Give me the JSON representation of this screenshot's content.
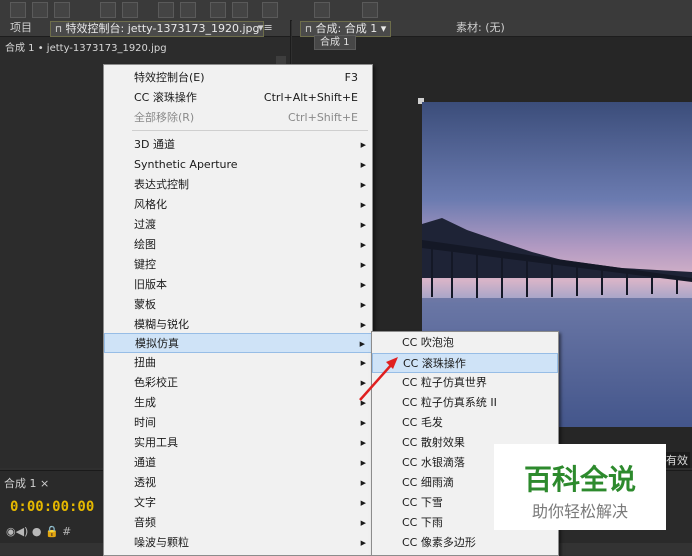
{
  "toolbar": {
    "icons": [
      "selection-tool-icon",
      "hand-tool-icon",
      "zoom-tool-icon",
      "rotate-tool-icon",
      "camera-tool-icon",
      "pan-behind-icon",
      "mask-tool-icon",
      "pen-tool-icon",
      "text-tool-icon",
      "brush-tool-icon",
      "clone-stamp-icon",
      "eraser-tool-icon"
    ]
  },
  "left_panel": {
    "tabs": {
      "project": "项目",
      "effect_controls": "特效控制台: jetty-1373173_1920.jpg",
      "menu_glyph": "▾≡"
    },
    "breadcrumb": "合成 1 • jetty-1373173_1920.jpg"
  },
  "right_panel": {
    "tabs": {
      "composition": "合成: 合成 1",
      "footage": "素材: (无)"
    },
    "comp_button": "合成 1",
    "right_label": "有效"
  },
  "timeline": {
    "tab_label": "合成 1 ×",
    "timecode": "0:00:00:00",
    "controls": "◉◀) ● 🔒   #"
  },
  "context_menu": {
    "items": [
      {
        "label": "特效控制台(E)",
        "shortcut": "F3",
        "submenu": false,
        "disabled": false
      },
      {
        "label": "CC 滚珠操作",
        "shortcut": "Ctrl+Alt+Shift+E",
        "submenu": false,
        "disabled": false
      },
      {
        "label": "全部移除(R)",
        "shortcut": "Ctrl+Shift+E",
        "submenu": false,
        "disabled": true
      },
      {
        "label": "3D 通道",
        "submenu": true
      },
      {
        "label": "Synthetic Aperture",
        "submenu": true
      },
      {
        "label": "表达式控制",
        "submenu": true
      },
      {
        "label": "风格化",
        "submenu": true
      },
      {
        "label": "过渡",
        "submenu": true
      },
      {
        "label": "绘图",
        "submenu": true
      },
      {
        "label": "键控",
        "submenu": true
      },
      {
        "label": "旧版本",
        "submenu": true
      },
      {
        "label": "蒙板",
        "submenu": true
      },
      {
        "label": "模糊与锐化",
        "submenu": true
      },
      {
        "label": "模拟仿真",
        "submenu": true,
        "highlighted": true
      },
      {
        "label": "扭曲",
        "submenu": true
      },
      {
        "label": "色彩校正",
        "submenu": true
      },
      {
        "label": "生成",
        "submenu": true
      },
      {
        "label": "时间",
        "submenu": true
      },
      {
        "label": "实用工具",
        "submenu": true
      },
      {
        "label": "通道",
        "submenu": true
      },
      {
        "label": "透视",
        "submenu": true
      },
      {
        "label": "文字",
        "submenu": true
      },
      {
        "label": "音频",
        "submenu": true
      },
      {
        "label": "噪波与颗粒",
        "submenu": true
      }
    ]
  },
  "submenu": {
    "items": [
      {
        "label": "CC 吹泡泡"
      },
      {
        "label": "CC 滚珠操作",
        "highlighted": true
      },
      {
        "label": "CC 粒子仿真世界"
      },
      {
        "label": "CC 粒子仿真系统 II"
      },
      {
        "label": "CC 毛发"
      },
      {
        "label": "CC 散射效果"
      },
      {
        "label": "CC 水银滴落"
      },
      {
        "label": "CC 细雨滴"
      },
      {
        "label": "CC 下雪"
      },
      {
        "label": "CC 下雨"
      },
      {
        "label": "CC 像素多边形"
      }
    ]
  },
  "watermark": {
    "title": "百科全说",
    "subtitle": "助你轻松解决"
  },
  "colors": {
    "timecode": "#e5b800",
    "menu_highlight": "#cfe3f7",
    "watermark_green": "#2d8a2d",
    "arrow_red": "#e02020"
  }
}
